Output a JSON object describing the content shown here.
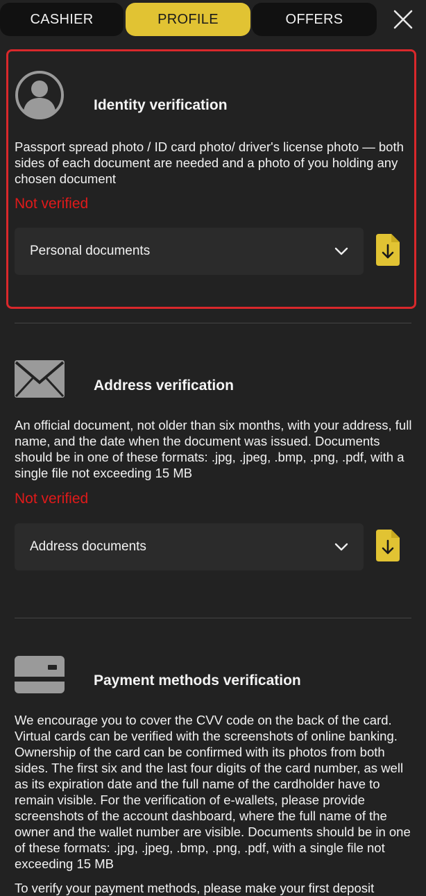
{
  "tabs": {
    "cashier": "CASHIER",
    "profile": "PROFILE",
    "offers": "OFFERS"
  },
  "colors": {
    "accent": "#e1c333",
    "status_unverified": "#e01a1a",
    "highlight_border": "#d9282b"
  },
  "sections": {
    "identity": {
      "icon": "user-avatar-icon",
      "title": "Identity verification",
      "description": "Passport spread photo / ID card photo/ driver's license photo — both sides of each document are needed and a photo of you holding any chosen document",
      "status": "Not verified",
      "select_value": "Personal documents"
    },
    "address": {
      "icon": "envelope-icon",
      "title": "Address verification",
      "description": "An official document, not older than six months, with your address, full name, and the date when the document was issued. Documents should be in one of these formats: .jpg, .jpeg, .bmp, .png, .pdf, with a single file not exceeding 15 MB",
      "status": "Not verified",
      "select_value": "Address documents"
    },
    "payment": {
      "icon": "credit-card-icon",
      "title": "Payment methods verification",
      "description": "We encourage you to cover the CVV code on the back of the card. Virtual cards can be verified with the screenshots of online banking. Ownership of the card can be confirmed with its photos from both sides. The first six and the last four digits of the card number, as well as its expiration date and the full name of the cardholder have to remain visible. For the verification of e-wallets, please provide screenshots of the account dashboard, where the full name of the owner and the wallet number are visible. Documents should be in one of these formats: .jpg, .jpeg, .bmp, .png, .pdf, with a single file not exceeding 15 MB",
      "footer_note": "To verify your payment methods, please make your first deposit"
    }
  }
}
